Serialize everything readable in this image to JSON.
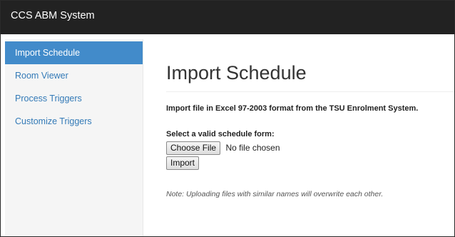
{
  "app": {
    "brand": "CCS ABM System"
  },
  "sidebar": {
    "items": [
      {
        "label": "Import Schedule",
        "active": true
      },
      {
        "label": "Room Viewer"
      },
      {
        "label": "Process Triggers"
      },
      {
        "label": "Customize Triggers"
      }
    ]
  },
  "main": {
    "title": "Import Schedule",
    "instructions": "Import file in Excel 97-2003 format from the TSU Enrolment System.",
    "file_label": "Select a valid schedule form:",
    "choose_button": "Choose File",
    "file_status": "No file chosen",
    "import_button": "Import",
    "note": "Note: Uploading files with similar names will overwrite each other."
  },
  "colors": {
    "navbar": "#222222",
    "sidebar_active": "#428bca",
    "link": "#337ab7"
  }
}
